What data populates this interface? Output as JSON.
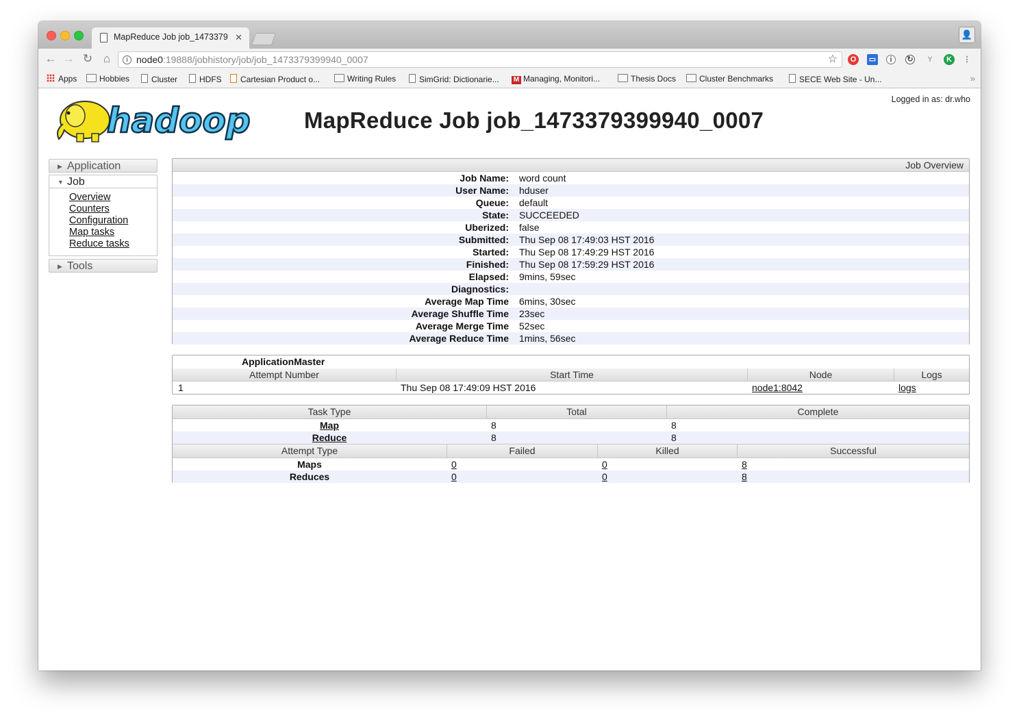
{
  "browser": {
    "tab_title": "MapReduce Job job_1473379",
    "url_host": "node0",
    "url_path": ":19888/jobhistory/job/job_1473379399940_0007",
    "bookmarks": [
      "Apps",
      "Hobbies",
      "Cluster",
      "HDFS",
      "Cartesian Product o...",
      "Writing Rules",
      "SimGrid: Dictionarie...",
      "Managing, Monitori...",
      "Thesis Docs",
      "Cluster Benchmarks",
      "SECE Web Site - Un..."
    ]
  },
  "header": {
    "logo_text": "hadoop",
    "title": "MapReduce Job job_1473379399940_0007",
    "logged_in": "Logged in as: dr.who"
  },
  "nav": {
    "application": "Application",
    "job": "Job",
    "job_links": [
      "Overview",
      "Counters",
      "Configuration",
      "Map tasks",
      "Reduce tasks"
    ],
    "tools": "Tools"
  },
  "overview": {
    "caption": "Job Overview",
    "rows": [
      {
        "label": "Job Name:",
        "value": "word count"
      },
      {
        "label": "User Name:",
        "value": "hduser"
      },
      {
        "label": "Queue:",
        "value": "default"
      },
      {
        "label": "State:",
        "value": "SUCCEEDED"
      },
      {
        "label": "Uberized:",
        "value": "false"
      },
      {
        "label": "Submitted:",
        "value": "Thu Sep 08 17:49:03 HST 2016"
      },
      {
        "label": "Started:",
        "value": "Thu Sep 08 17:49:29 HST 2016"
      },
      {
        "label": "Finished:",
        "value": "Thu Sep 08 17:59:29 HST 2016"
      },
      {
        "label": "Elapsed:",
        "value": "9mins, 59sec"
      },
      {
        "label": "Diagnostics:",
        "value": ""
      },
      {
        "label": "Average Map Time",
        "value": "6mins, 30sec"
      },
      {
        "label": "Average Shuffle Time",
        "value": "23sec"
      },
      {
        "label": "Average Merge Time",
        "value": "52sec"
      },
      {
        "label": "Average Reduce Time",
        "value": "1mins, 56sec"
      }
    ]
  },
  "am": {
    "title": "ApplicationMaster",
    "headers": [
      "Attempt Number",
      "Start Time",
      "Node",
      "Logs"
    ],
    "row": {
      "attempt": "1",
      "start": "Thu Sep 08 17:49:09 HST 2016",
      "node": "node1:8042",
      "logs": "logs"
    }
  },
  "tasks": {
    "headers": [
      "Task Type",
      "Total",
      "Complete"
    ],
    "rows": [
      {
        "type": "Map",
        "total": "8",
        "complete": "8"
      },
      {
        "type": "Reduce",
        "total": "8",
        "complete": "8"
      }
    ],
    "attempt_headers": [
      "Attempt Type",
      "Failed",
      "Killed",
      "Successful"
    ],
    "attempt_rows": [
      {
        "type": "Maps",
        "failed": "0",
        "killed": "0",
        "successful": "8"
      },
      {
        "type": "Reduces",
        "failed": "0",
        "killed": "0",
        "successful": "8"
      }
    ]
  }
}
